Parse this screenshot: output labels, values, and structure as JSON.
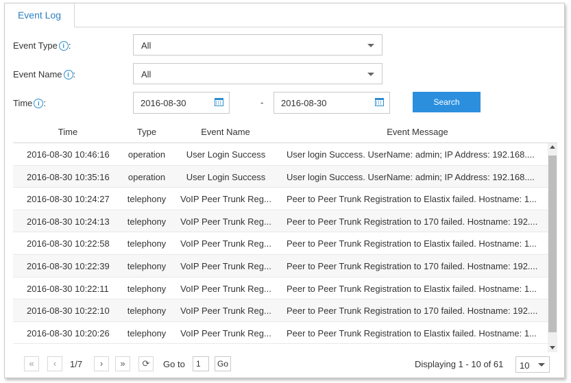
{
  "tab": {
    "label": "Event Log"
  },
  "filters": {
    "event_type": {
      "label": "Event Type",
      "suffix": ":",
      "value": "All"
    },
    "event_name": {
      "label": "Event Name",
      "suffix": ":",
      "value": "All"
    },
    "time": {
      "label": "Time",
      "suffix": ":",
      "from": "2016-08-30",
      "separator": "-",
      "to": "2016-08-30"
    },
    "info_icon": "i",
    "search_label": "Search"
  },
  "table": {
    "columns": [
      "Time",
      "Type",
      "Event Name",
      "Event Message"
    ],
    "rows": [
      [
        "2016-08-30 10:46:16",
        "operation",
        "User Login Success",
        "User login Success. UserName: admin; IP Address: 192.168...."
      ],
      [
        "2016-08-30 10:35:16",
        "operation",
        "User Login Success",
        "User login Success. UserName: admin; IP Address: 192.168...."
      ],
      [
        "2016-08-30 10:24:27",
        "telephony",
        "VoIP Peer Trunk Reg...",
        "Peer to Peer Trunk Registration to Elastix failed. Hostname: 1..."
      ],
      [
        "2016-08-30 10:24:13",
        "telephony",
        "VoIP Peer Trunk Reg...",
        "Peer to Peer Trunk Registration to 170 failed. Hostname: 192...."
      ],
      [
        "2016-08-30 10:22:58",
        "telephony",
        "VoIP Peer Trunk Reg...",
        "Peer to Peer Trunk Registration to Elastix failed. Hostname: 1..."
      ],
      [
        "2016-08-30 10:22:39",
        "telephony",
        "VoIP Peer Trunk Reg...",
        "Peer to Peer Trunk Registration to 170 failed. Hostname: 192...."
      ],
      [
        "2016-08-30 10:22:11",
        "telephony",
        "VoIP Peer Trunk Reg...",
        "Peer to Peer Trunk Registration to Elastix failed. Hostname: 1..."
      ],
      [
        "2016-08-30 10:22:10",
        "telephony",
        "VoIP Peer Trunk Reg...",
        "Peer to Peer Trunk Registration to 170 failed. Hostname: 192...."
      ],
      [
        "2016-08-30 10:20:26",
        "telephony",
        "VoIP Peer Trunk Reg...",
        "Peer to Peer Trunk Registration to Elastix failed. Hostname: 1..."
      ]
    ]
  },
  "pager": {
    "first": "«",
    "prev": "‹",
    "page": "1/7",
    "next": "›",
    "last": "»",
    "refresh": "⟳",
    "goto_label": "Go to",
    "goto_value": "1",
    "go_label": "Go",
    "display_text": "Displaying 1 - 10 of 61",
    "page_size": "10"
  },
  "colors": {
    "accent": "#2b8fde",
    "tab_text": "#2a7fc1"
  }
}
